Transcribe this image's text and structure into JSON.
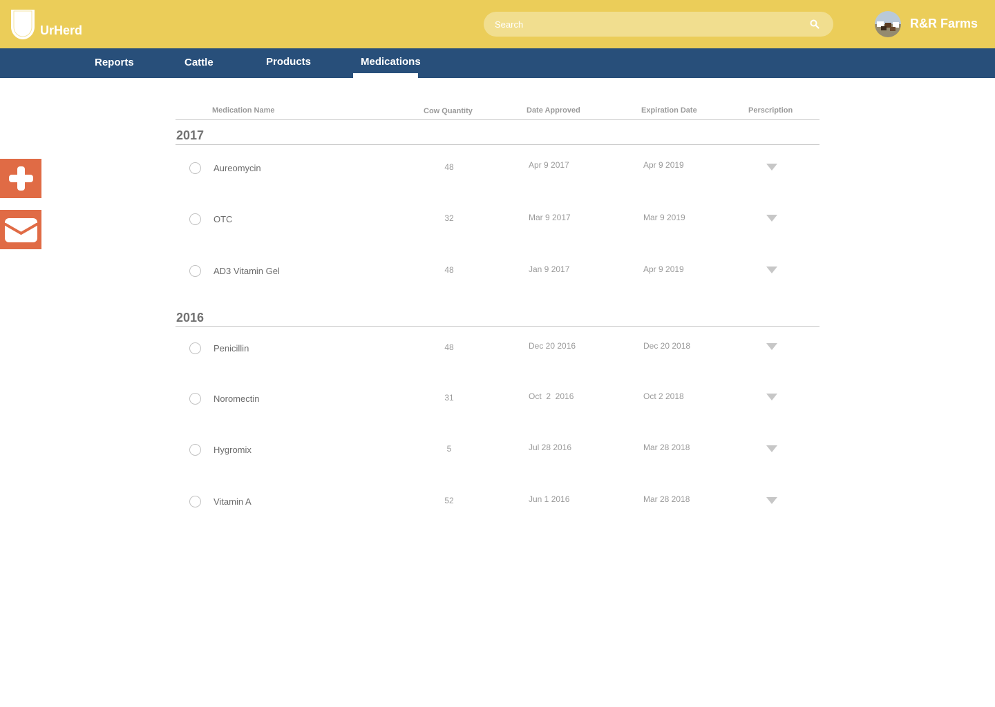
{
  "brand": {
    "name": "UrHerd"
  },
  "search": {
    "placeholder": "Search"
  },
  "account": {
    "name": "R&R Farms"
  },
  "nav": {
    "items": [
      "Reports",
      "Cattle",
      "Products",
      "Medications"
    ],
    "active": "Medications"
  },
  "side_actions": [
    {
      "icon": "plus-icon"
    },
    {
      "icon": "mail-icon"
    }
  ],
  "table": {
    "columns": [
      "Medication Name",
      "Cow Quantity",
      "Date Approved",
      "Expiration Date",
      "Perscription"
    ],
    "groups": [
      {
        "year": "2017",
        "rows": [
          {
            "name": "Aureomycin",
            "quantity": "48",
            "approved": "Apr 9 2017",
            "expiration": "Apr 9 2019"
          },
          {
            "name": "OTC",
            "quantity": "32",
            "approved": "Mar 9 2017",
            "expiration": "Mar 9 2019"
          },
          {
            "name": "AD3 Vitamin Gel",
            "quantity": "48",
            "approved": "Jan 9 2017",
            "expiration": "Apr 9 2019"
          }
        ]
      },
      {
        "year": "2016",
        "rows": [
          {
            "name": "Penicillin",
            "quantity": "48",
            "approved": "Dec 20 2016",
            "expiration": "Dec 20 2018"
          },
          {
            "name": "Noromectin",
            "quantity": "31",
            "approved": "Oct  2  2016",
            "expiration": "Oct 2 2018"
          },
          {
            "name": "Hygromix",
            "quantity": "5",
            "approved": "Jul 28 2016",
            "expiration": "Mar 28 2018"
          },
          {
            "name": "Vitamin A",
            "quantity": "52",
            "approved": "Jun 1 2016",
            "expiration": "Mar 28 2018"
          }
        ]
      }
    ]
  },
  "colors": {
    "header": "#ebcd59",
    "nav": "#284f7a",
    "accent": "#e06b45"
  }
}
